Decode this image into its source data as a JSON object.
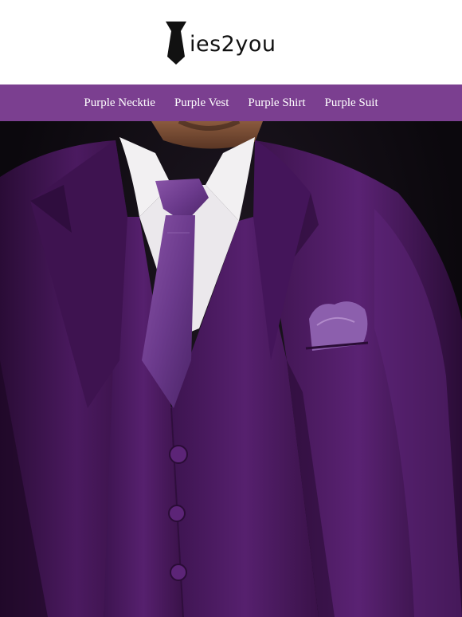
{
  "brand": {
    "logo_text": "ies2you",
    "logo_icon": "necktie-icon"
  },
  "nav": {
    "items": [
      {
        "label": "Purple Necktie"
      },
      {
        "label": "Purple Vest"
      },
      {
        "label": "Purple Shirt"
      },
      {
        "label": "Purple Suit"
      }
    ]
  },
  "hero": {
    "image": "man-in-purple-three-piece-suit",
    "colors": {
      "suit": "#4a1a5e",
      "suit_dark": "#2a0c36",
      "suit_light": "#6a2b82",
      "shirt": "#f2f0f2",
      "tie": "#6b3a8c",
      "nav": "#7b3f90"
    }
  }
}
